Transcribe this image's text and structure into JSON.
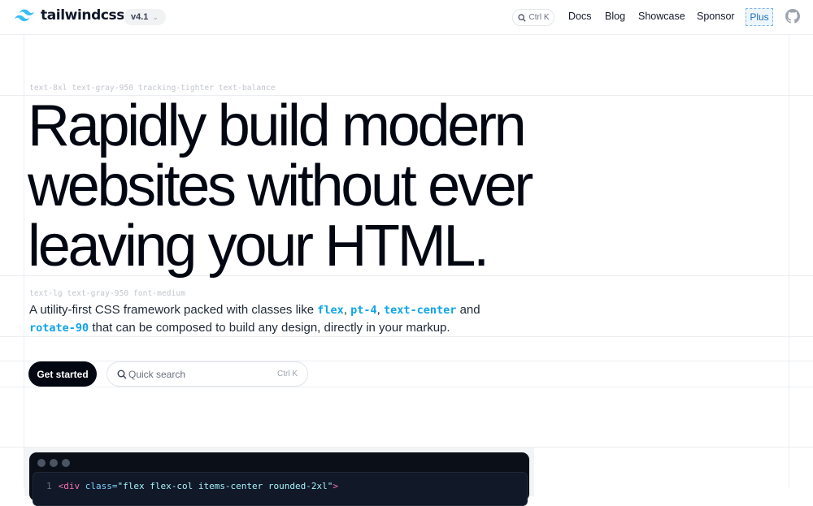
{
  "header": {
    "logo_text": "tailwindcss",
    "version": "v4.1",
    "search_shortcut": "Ctrl K",
    "nav": [
      "Docs",
      "Blog",
      "Showcase",
      "Sponsor"
    ],
    "plus_label": "Plus"
  },
  "hero": {
    "headline_label": "text-8xl text-gray-950 tracking-tighter text-balance",
    "headline_lines": [
      "Rapidly build modern",
      "websites without ever",
      "leaving your HTML."
    ],
    "lead_label": "text-lg text-gray-950 font-medium",
    "lead": {
      "t1": "A utility-first CSS framework packed with classes like ",
      "c1": "flex",
      "t2": ", ",
      "c2": "pt-4",
      "t3": ", ",
      "c3": "text-center",
      "t4": " and ",
      "c4": "rotate-90",
      "t5": " that can be composed to build any design, directly in your markup."
    },
    "cta_label": "Get started",
    "search_placeholder": "Quick search",
    "search_shortcut": "Ctrl K"
  },
  "code": {
    "line_number": "1",
    "tag_open": "<div",
    "attr": " class=",
    "value": "\"flex flex-col items-center rounded-2xl\"",
    "tag_close": ">"
  },
  "colors": {
    "text": "#030712",
    "accent": "#0ea5e9",
    "brand": "#38bdf8"
  }
}
